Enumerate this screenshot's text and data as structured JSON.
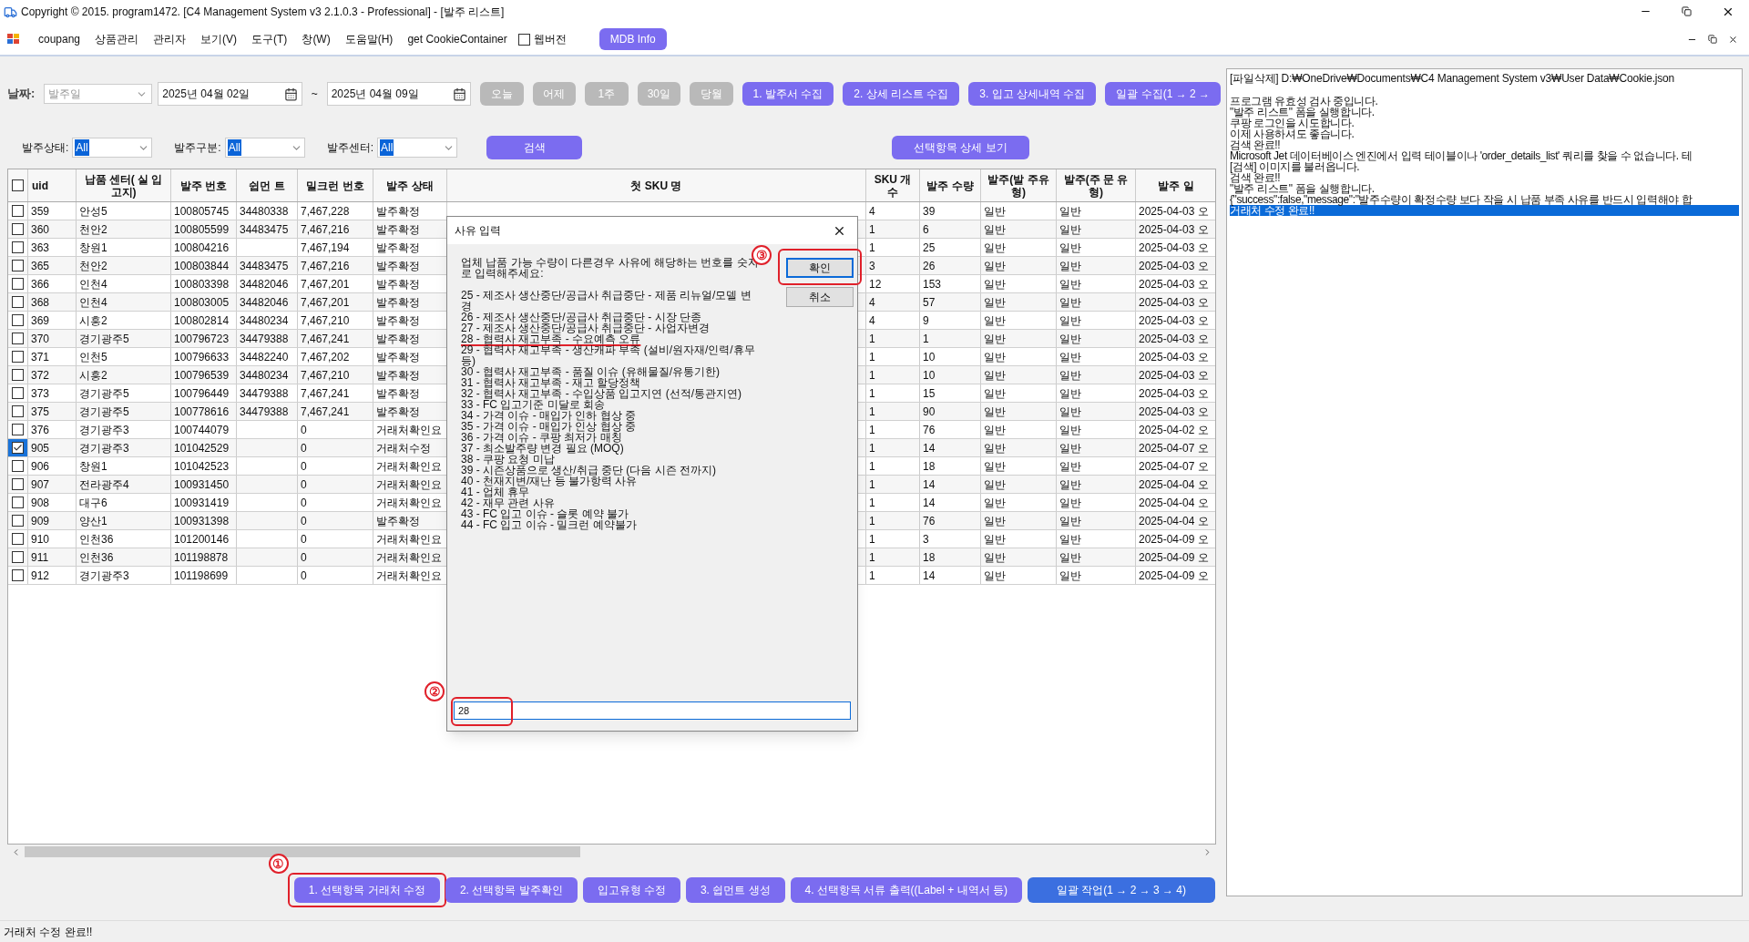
{
  "window": {
    "title": "Copyright © 2015. program1472. [C4 Management System v3 2.1.0.3 - Professional] - [발주 리스트]"
  },
  "menu": {
    "items": [
      "coupang",
      "상품관리",
      "관리자",
      "보기(V)",
      "도구(T)",
      "창(W)",
      "도움말(H)",
      "get CookieContainer"
    ],
    "web_version": {
      "label": "웹버전",
      "checked": false
    },
    "mdb_button": "MDB Info"
  },
  "toolbar": {
    "date_label": "날짜:",
    "date_type": {
      "value": "발주일",
      "disabled": true
    },
    "date_from": "2025년 04월 02일",
    "tilde": "~",
    "date_to": "2025년 04월 09일",
    "quick_buttons": [
      {
        "label": "오늘",
        "disabled": true
      },
      {
        "label": "어제",
        "disabled": true
      },
      {
        "label": "1주",
        "disabled": true
      },
      {
        "label": "30일",
        "disabled": true
      },
      {
        "label": "당월",
        "disabled": true
      }
    ],
    "collect_buttons": [
      "1. 발주서 수집",
      "2. 상세 리스트 수집",
      "3. 입고 상세내역 수집",
      "일괄 수집(1 → 2 →"
    ]
  },
  "filters": [
    {
      "label": "발주상태:",
      "value": "All"
    },
    {
      "label": "발주구분:",
      "value": "All"
    },
    {
      "label": "발주센터:",
      "value": "All"
    }
  ],
  "search_button": "검색",
  "detail_button": "선택항목 상세 보기",
  "table": {
    "select_all_checked": false,
    "columns": [
      "uid",
      "납품 센터( 실 입고지)",
      "발주 번호",
      "쉽먼 트",
      "밀크런 번호",
      "발주 상태",
      "첫 SKU 명",
      "SKU 개수",
      "발주 수량",
      "발주(발 주유형)",
      "발주(주 문 유형)",
      "발주 일"
    ],
    "rows": [
      {
        "checked": false,
        "cells": [
          "359",
          "안성5",
          "100805745",
          "34480338",
          "7,467,228",
          "발주확정",
          "",
          "4",
          "39",
          "일반",
          "일반",
          "2025-04-03 오"
        ]
      },
      {
        "checked": false,
        "cells": [
          "360",
          "천안2",
          "100805599",
          "34483475",
          "7,467,216",
          "발주확정",
          "",
          "1",
          "6",
          "일반",
          "일반",
          "2025-04-03 오"
        ]
      },
      {
        "checked": false,
        "cells": [
          "363",
          "창원1",
          "100804216",
          "",
          "7,467,194",
          "발주확정",
          "",
          "1",
          "25",
          "일반",
          "일반",
          "2025-04-03 오"
        ]
      },
      {
        "checked": false,
        "cells": [
          "365",
          "천안2",
          "100803844",
          "34483475",
          "7,467,216",
          "발주확정",
          "",
          "3",
          "26",
          "일반",
          "일반",
          "2025-04-03 오"
        ]
      },
      {
        "checked": false,
        "cells": [
          "366",
          "인천4",
          "100803398",
          "34482046",
          "7,467,201",
          "발주확정",
          "",
          "12",
          "153",
          "일반",
          "일반",
          "2025-04-03 오"
        ]
      },
      {
        "checked": false,
        "cells": [
          "368",
          "인천4",
          "100803005",
          "34482046",
          "7,467,201",
          "발주확정",
          "",
          "4",
          "57",
          "일반",
          "일반",
          "2025-04-03 오"
        ]
      },
      {
        "checked": false,
        "cells": [
          "369",
          "시흥2",
          "100802814",
          "34480234",
          "7,467,210",
          "발주확정",
          "",
          "4",
          "9",
          "일반",
          "일반",
          "2025-04-03 오"
        ]
      },
      {
        "checked": false,
        "cells": [
          "370",
          "경기광주5",
          "100796723",
          "34479388",
          "7,467,241",
          "발주확정",
          "",
          "1",
          "1",
          "일반",
          "일반",
          "2025-04-03 오"
        ]
      },
      {
        "checked": false,
        "cells": [
          "371",
          "인천5",
          "100796633",
          "34482240",
          "7,467,202",
          "발주확정",
          "",
          "1",
          "10",
          "일반",
          "일반",
          "2025-04-03 오"
        ]
      },
      {
        "checked": false,
        "cells": [
          "372",
          "시흥2",
          "100796539",
          "34480234",
          "7,467,210",
          "발주확정",
          "",
          "1",
          "10",
          "일반",
          "일반",
          "2025-04-03 오"
        ]
      },
      {
        "checked": false,
        "cells": [
          "373",
          "경기광주5",
          "100796449",
          "34479388",
          "7,467,241",
          "발주확정",
          "",
          "1",
          "15",
          "일반",
          "일반",
          "2025-04-03 오"
        ]
      },
      {
        "checked": false,
        "cells": [
          "375",
          "경기광주5",
          "100778616",
          "34479388",
          "7,467,241",
          "발주확정",
          "",
          "1",
          "90",
          "일반",
          "일반",
          "2025-04-03 오"
        ]
      },
      {
        "checked": false,
        "cells": [
          "376",
          "경기광주3",
          "100744079",
          "",
          "0",
          "거래처확인요",
          "",
          "1",
          "76",
          "일반",
          "일반",
          "2025-04-02 오"
        ]
      },
      {
        "checked": true,
        "cells": [
          "905",
          "경기광주3",
          "101042529",
          "",
          "0",
          "거래처수정",
          "",
          "1",
          "14",
          "일반",
          "일반",
          "2025-04-07 오"
        ]
      },
      {
        "checked": false,
        "cells": [
          "906",
          "창원1",
          "101042523",
          "",
          "0",
          "거래처확인요",
          "",
          "1",
          "18",
          "일반",
          "일반",
          "2025-04-07 오"
        ]
      },
      {
        "checked": false,
        "cells": [
          "907",
          "전라광주4",
          "100931450",
          "",
          "0",
          "거래처확인요",
          "",
          "1",
          "14",
          "일반",
          "일반",
          "2025-04-04 오"
        ]
      },
      {
        "checked": false,
        "cells": [
          "908",
          "대구6",
          "100931419",
          "",
          "0",
          "거래처확인요",
          "",
          "1",
          "14",
          "일반",
          "일반",
          "2025-04-04 오"
        ]
      },
      {
        "checked": false,
        "cells": [
          "909",
          "양산1",
          "100931398",
          "",
          "0",
          "발주확정",
          "",
          "1",
          "76",
          "일반",
          "일반",
          "2025-04-04 오"
        ]
      },
      {
        "checked": false,
        "cells": [
          "910",
          "인천36",
          "101200146",
          "",
          "0",
          "거래처확인요",
          "",
          "1",
          "3",
          "일반",
          "일반",
          "2025-04-09 오"
        ]
      },
      {
        "checked": false,
        "cells": [
          "911",
          "인천36",
          "101198878",
          "",
          "0",
          "거래처확인요",
          "",
          "1",
          "18",
          "일반",
          "일반",
          "2025-04-09 오"
        ]
      },
      {
        "checked": false,
        "cells": [
          "912",
          "경기광주3",
          "101198699",
          "",
          "0",
          "거래처확인요",
          "",
          "1",
          "14",
          "일반",
          "일반",
          "2025-04-09 오"
        ]
      }
    ]
  },
  "dialog": {
    "title": "사유 입력",
    "message": "업체 납품 가능 수량이 다른경우 사유에 해당하는 번호를 숫자로 입력해주세요:",
    "reasons": [
      {
        "text": "25 - 제조사 생산중단/공급사 취급중단 - 제품 리뉴얼/모델 변경",
        "underlined": false
      },
      {
        "text": "26 - 제조사 생산중단/공급사 취급중단 - 시장 단종",
        "underlined": false
      },
      {
        "text": "27 - 제조사 생산중단/공급사 취급중단 - 사업자변경",
        "underlined": false
      },
      {
        "text": "28 - 협력사 재고부족 - 수요예측 오류",
        "underlined": true
      },
      {
        "text": "29 - 협력사 재고부족 - 생산캐파 부족 (설비/원자재/인력/휴무 등)",
        "underlined": false
      },
      {
        "text": "30 - 협력사 재고부족 - 품질 이슈 (유해물질/유통기한)",
        "underlined": false
      },
      {
        "text": "31 - 협력사 재고부족 - 재고 할당정책",
        "underlined": false
      },
      {
        "text": "32 - 협력사 재고부족 - 수입상품 입고지연 (선적/통관지연)",
        "underlined": false
      },
      {
        "text": "33 - FC 입고기준 미달로 회송",
        "underlined": false
      },
      {
        "text": "34 - 가격 이슈 - 매입가 인하 협상 중",
        "underlined": false
      },
      {
        "text": "35 - 가격 이슈 - 매입가 인상 협상 중",
        "underlined": false
      },
      {
        "text": "36 - 가격 이슈 - 쿠팡 최저가 매칭",
        "underlined": false
      },
      {
        "text": "37 - 최소발주량 변경 필요 (MOQ)",
        "underlined": false
      },
      {
        "text": "38 - 쿠팡 요청 미납",
        "underlined": false
      },
      {
        "text": "39 - 시즌상품으로 생산/취급 중단 (다음 시즌 전까지)",
        "underlined": false
      },
      {
        "text": "40 - 천재지변/재난 등 불가항력 사유",
        "underlined": false
      },
      {
        "text": "41 - 업체 휴무",
        "underlined": false
      },
      {
        "text": "42 - 재무 관련 사유",
        "underlined": false
      },
      {
        "text": "43 - FC 입고 이슈 - 슬롯 예약 불가",
        "underlined": false
      },
      {
        "text": "44 - FC 입고 이슈 - 밀크런 예약불가",
        "underlined": false
      }
    ],
    "input": {
      "value": "28",
      "annotation": "②"
    },
    "ok": {
      "label": "확인",
      "annotation": "③"
    },
    "cancel": {
      "label": "취소"
    }
  },
  "bottom_buttons": [
    {
      "label": "1. 선택항목 거래처 수정",
      "kind": "action",
      "annotation": "①"
    },
    {
      "label": "2. 선택항목 발주확인",
      "kind": "action"
    },
    {
      "label": "입고유형 수정",
      "kind": "action"
    },
    {
      "label": "3. 쉽먼트 생성",
      "kind": "action"
    },
    {
      "label": "4. 선택항목 서류 출력((Label + 내역서 등)",
      "kind": "action"
    },
    {
      "label": "일괄 작업(1 → 2 → 3 → 4)",
      "kind": "primary"
    }
  ],
  "log": {
    "path_line": "[파일삭제] D:₩OneDrive₩Documents₩C4 Management System v3₩User Data₩Cookie.json",
    "lines": [
      {
        "text": "프로그램 유효성 검사 중입니다.",
        "selected": false
      },
      {
        "text": "\"발주 리스트\" 폼을 실행합니다.",
        "selected": false
      },
      {
        "text": "쿠팡 로그인을 시도합니다.",
        "selected": false
      },
      {
        "text": "이제 사용하셔도 좋습니다.",
        "selected": false
      },
      {
        "text": "검색 완료!!",
        "selected": false
      },
      {
        "text": "Microsoft Jet 데이터베이스 엔진에서 입력 테이블이나 'order_details_list' 쿼리를 찾을 수 없습니다. 테",
        "selected": false
      },
      {
        "text": "[검색] 이미지를 불러옵니다.",
        "selected": false
      },
      {
        "text": "검색 완료!!",
        "selected": false
      },
      {
        "text": "\"발주 리스트\" 폼을 실행합니다.",
        "selected": false
      },
      {
        "text": "{\"success\":false,\"message\":\"발주수량이 확정수량 보다 작을 시 납품 부족 사유를 반드시 입력해야 합",
        "selected": false
      },
      {
        "text": "거래처 수정 완료!!",
        "selected": true
      }
    ]
  },
  "status_bar": "거래처 수정 완료!!"
}
